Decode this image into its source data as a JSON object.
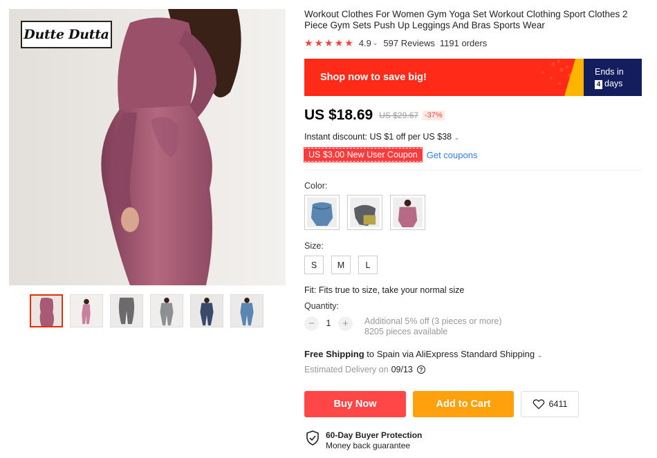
{
  "brand": {
    "logo_text": "Dutte Dutta"
  },
  "product": {
    "title": "Workout Clothes For Women Gym Yoga Set Workout Clothing Sport Clothes 2 Piece Gym Sets Push Up Leggings And Bras Sports Wear",
    "rating": {
      "stars": 5,
      "value": "4.9",
      "reviews": "597 Reviews",
      "orders": "1191 orders"
    }
  },
  "promo": {
    "text": "Shop now to save big!",
    "ends_label": "Ends in",
    "days_count": "4",
    "days_label": "days",
    "colors": {
      "banner": "#ff2a18",
      "timer": "#141d5e"
    }
  },
  "pricing": {
    "price": "US $18.69",
    "old_price": "US $29.67",
    "discount": "-37%",
    "instant_discount": "Instant discount: US $1 off per US $38",
    "coupon": "US $3.00 New User Coupon",
    "get_coupons": "Get coupons"
  },
  "options": {
    "color_label": "Color:",
    "colors": [
      {
        "name": "blue-swatch-icon",
        "fill": "#5a86b2"
      },
      {
        "name": "gray-swatch-icon",
        "fill": "#6d6e73"
      },
      {
        "name": "pink-swatch-icon",
        "fill": "#b76a85"
      }
    ],
    "size_label": "Size:",
    "sizes": [
      "S",
      "M",
      "L"
    ],
    "fit": "Fit: Fits true to size, take your normal size"
  },
  "quantity": {
    "label": "Quantity:",
    "value": "1",
    "minus": "−",
    "plus": "+",
    "note_discount": "Additional 5% off (3 pieces or more)",
    "note_available": "8205 pieces available"
  },
  "shipping": {
    "free": "Free Shipping",
    "destination": " to Spain via AliExpress Standard Shipping",
    "delivery_label": "Estimated Delivery on",
    "delivery_date": "09/13"
  },
  "actions": {
    "buy_now": "Buy Now",
    "add_to_cart": "Add to Cart",
    "wishlist_count": "6411"
  },
  "protection": {
    "title": "60-Day Buyer Protection",
    "subtitle": "Money back guarantee"
  },
  "colors": {
    "accent": "#ff4747",
    "cart": "#ffa10c",
    "link": "#2f7ed8"
  }
}
